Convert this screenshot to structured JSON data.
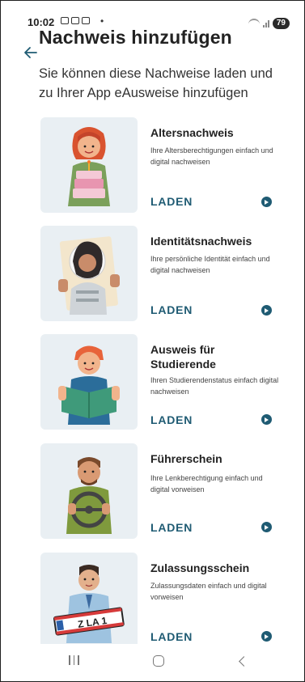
{
  "status_bar": {
    "time": "10:02",
    "battery": "79"
  },
  "header": {
    "title": "Nachweis hinzufügen",
    "subtitle": "Sie können diese Nachweise laden und zu Ihrer App eAusweise hinzufügen"
  },
  "cards": [
    {
      "title": "Altersnachweis",
      "description": "Ihre Altersberechtigungen einfach und digital nachweisen",
      "action": "LADEN"
    },
    {
      "title": "Identitätsnachweis",
      "description": "Ihre persönliche Identität einfach und digital nachweisen",
      "action": "LADEN"
    },
    {
      "title": "Ausweis für Studierende",
      "description": "Ihren Studierendenstatus einfach digital nachweisen",
      "action": "LADEN"
    },
    {
      "title": "Führerschein",
      "description": "Ihre Lenkberechtigung einfach und digital vorweisen",
      "action": "LADEN"
    },
    {
      "title": "Zulassungsschein",
      "description": "Zulassungsdaten einfach und digital vorweisen",
      "action": "LADEN",
      "plate_text": "Z LA 1"
    }
  ],
  "colors": {
    "accent": "#1f5b73",
    "thumb_background": "#e9eff3"
  }
}
